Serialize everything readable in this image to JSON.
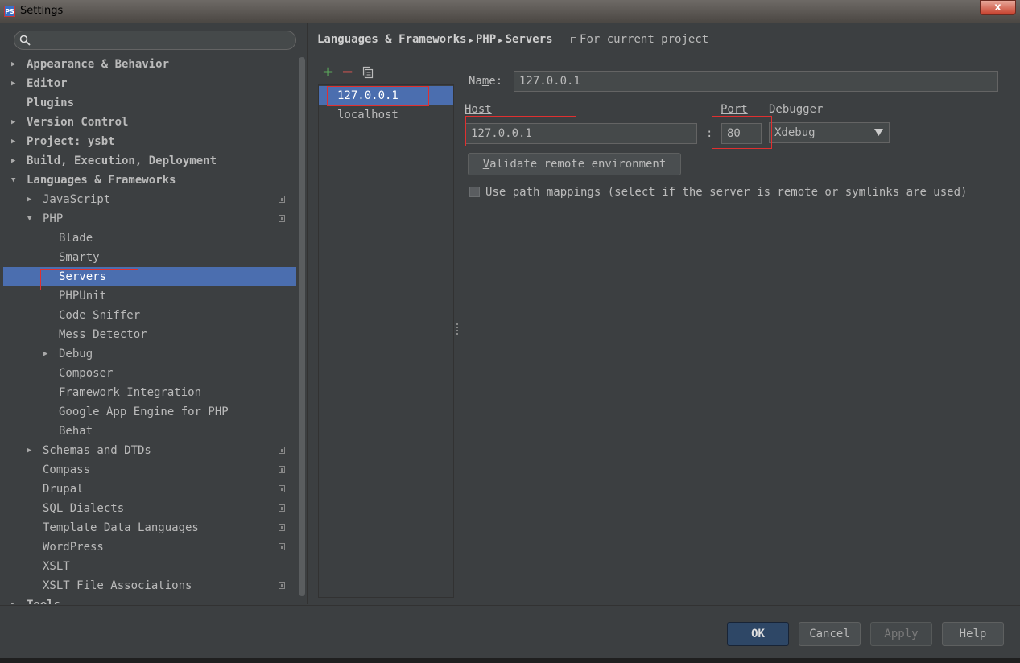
{
  "window": {
    "title": "Settings",
    "app_icon": "phpstorm-icon",
    "close_glyph": "x"
  },
  "search": {
    "value": "",
    "placeholder": ""
  },
  "tree": [
    {
      "label": "Appearance & Behavior",
      "level": 0,
      "arrow": "right",
      "bold": true
    },
    {
      "label": "Editor",
      "level": 0,
      "arrow": "right",
      "bold": true
    },
    {
      "label": "Plugins",
      "level": 0,
      "arrow": "",
      "bold": true
    },
    {
      "label": "Version Control",
      "level": 0,
      "arrow": "right",
      "bold": true
    },
    {
      "label": "Project: ysbt",
      "level": 0,
      "arrow": "right",
      "bold": true
    },
    {
      "label": "Build, Execution, Deployment",
      "level": 0,
      "arrow": "right",
      "bold": true
    },
    {
      "label": "Languages & Frameworks",
      "level": 0,
      "arrow": "down",
      "bold": true
    },
    {
      "label": "JavaScript",
      "level": 1,
      "arrow": "right",
      "project": true
    },
    {
      "label": "PHP",
      "level": 1,
      "arrow": "down",
      "project": true
    },
    {
      "label": "Blade",
      "level": 2,
      "arrow": ""
    },
    {
      "label": "Smarty",
      "level": 2,
      "arrow": ""
    },
    {
      "label": "Servers",
      "level": 2,
      "arrow": "",
      "selected": true
    },
    {
      "label": "PHPUnit",
      "level": 2,
      "arrow": ""
    },
    {
      "label": "Code Sniffer",
      "level": 2,
      "arrow": ""
    },
    {
      "label": "Mess Detector",
      "level": 2,
      "arrow": ""
    },
    {
      "label": "Debug",
      "level": 2,
      "arrow": "right"
    },
    {
      "label": "Composer",
      "level": 2,
      "arrow": ""
    },
    {
      "label": "Framework Integration",
      "level": 2,
      "arrow": ""
    },
    {
      "label": "Google App Engine for PHP",
      "level": 2,
      "arrow": ""
    },
    {
      "label": "Behat",
      "level": 2,
      "arrow": ""
    },
    {
      "label": "Schemas and DTDs",
      "level": 1,
      "arrow": "right",
      "project": true
    },
    {
      "label": "Compass",
      "level": 1,
      "arrow": "",
      "project": true
    },
    {
      "label": "Drupal",
      "level": 1,
      "arrow": "",
      "project": true
    },
    {
      "label": "SQL Dialects",
      "level": 1,
      "arrow": "",
      "project": true
    },
    {
      "label": "Template Data Languages",
      "level": 1,
      "arrow": "",
      "project": true
    },
    {
      "label": "WordPress",
      "level": 1,
      "arrow": "",
      "project": true
    },
    {
      "label": "XSLT",
      "level": 1,
      "arrow": ""
    },
    {
      "label": "XSLT File Associations",
      "level": 1,
      "arrow": "",
      "project": true
    },
    {
      "label": "Tools",
      "level": 0,
      "arrow": "right",
      "bold": true
    }
  ],
  "breadcrumb": {
    "items": [
      "Languages & Frameworks",
      "PHP",
      "Servers"
    ],
    "separator": "▶",
    "project_note": "For current project"
  },
  "toolbar": {
    "add_glyph": "+",
    "remove_glyph": "−",
    "copy_icon": "copy-icon"
  },
  "servers": [
    {
      "name": "127.0.0.1",
      "selected": true
    },
    {
      "name": "localhost",
      "selected": false
    }
  ],
  "form": {
    "name_label_pre": "Na",
    "name_label_mn": "m",
    "name_label_post": "e:",
    "name_value": "127.0.0.1",
    "host_label": "Host",
    "host_value": "127.0.0.1",
    "colon": ":",
    "port_label": "Port",
    "port_value": "80",
    "debugger_label": "Debugger",
    "debugger_value": "Xdebug",
    "validate_mn": "V",
    "validate_rest": "alidate remote environment",
    "path_mappings_checked": false,
    "path_mappings_label": "Use path mappings (select if the server is remote or symlinks are used)"
  },
  "buttons": {
    "ok": "OK",
    "cancel": "Cancel",
    "apply": "Apply",
    "help": "Help"
  },
  "colors": {
    "selection": "#4b6eaf",
    "background": "#3c3f41",
    "highlight": "#e03030",
    "add": "#5ca85c",
    "remove": "#c75450"
  }
}
